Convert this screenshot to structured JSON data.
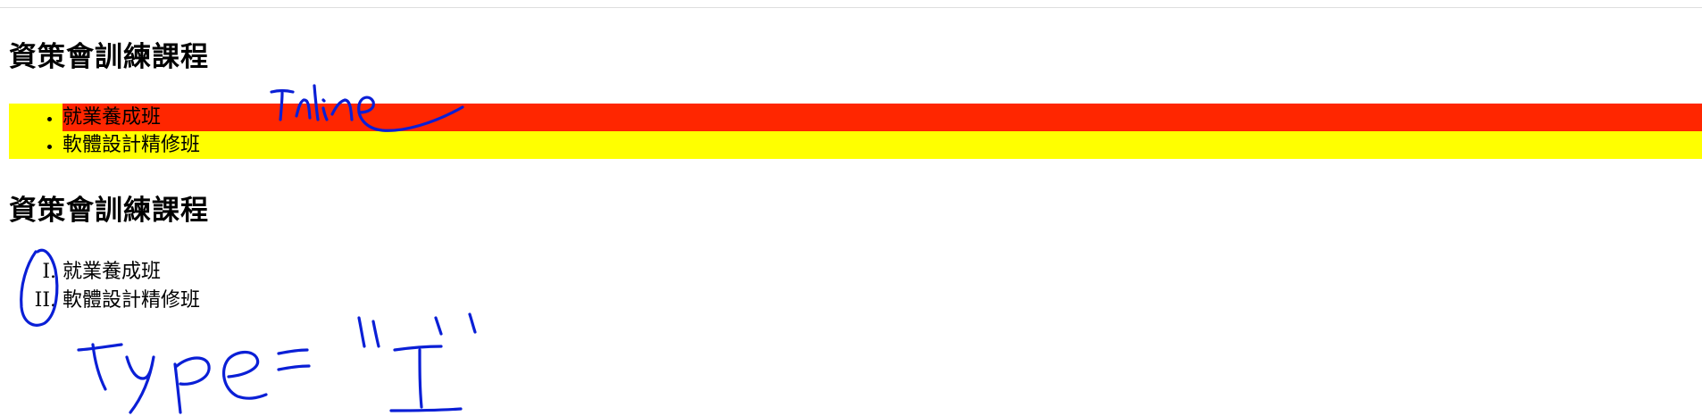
{
  "sections": [
    {
      "heading": "資策會訓練課程",
      "list_style": "disc",
      "items": [
        "就業養成班",
        "軟體設計精修班"
      ],
      "item_colors": [
        "#ff2600",
        "#ffff00"
      ]
    },
    {
      "heading": "資策會訓練課程",
      "list_style": "upper-roman",
      "items": [
        "就業養成班",
        "軟體設計精修班"
      ]
    }
  ],
  "annotations": {
    "ink_color": "#0a1fd6",
    "note_inline": "Inline",
    "note_type": "type = \"I\""
  }
}
